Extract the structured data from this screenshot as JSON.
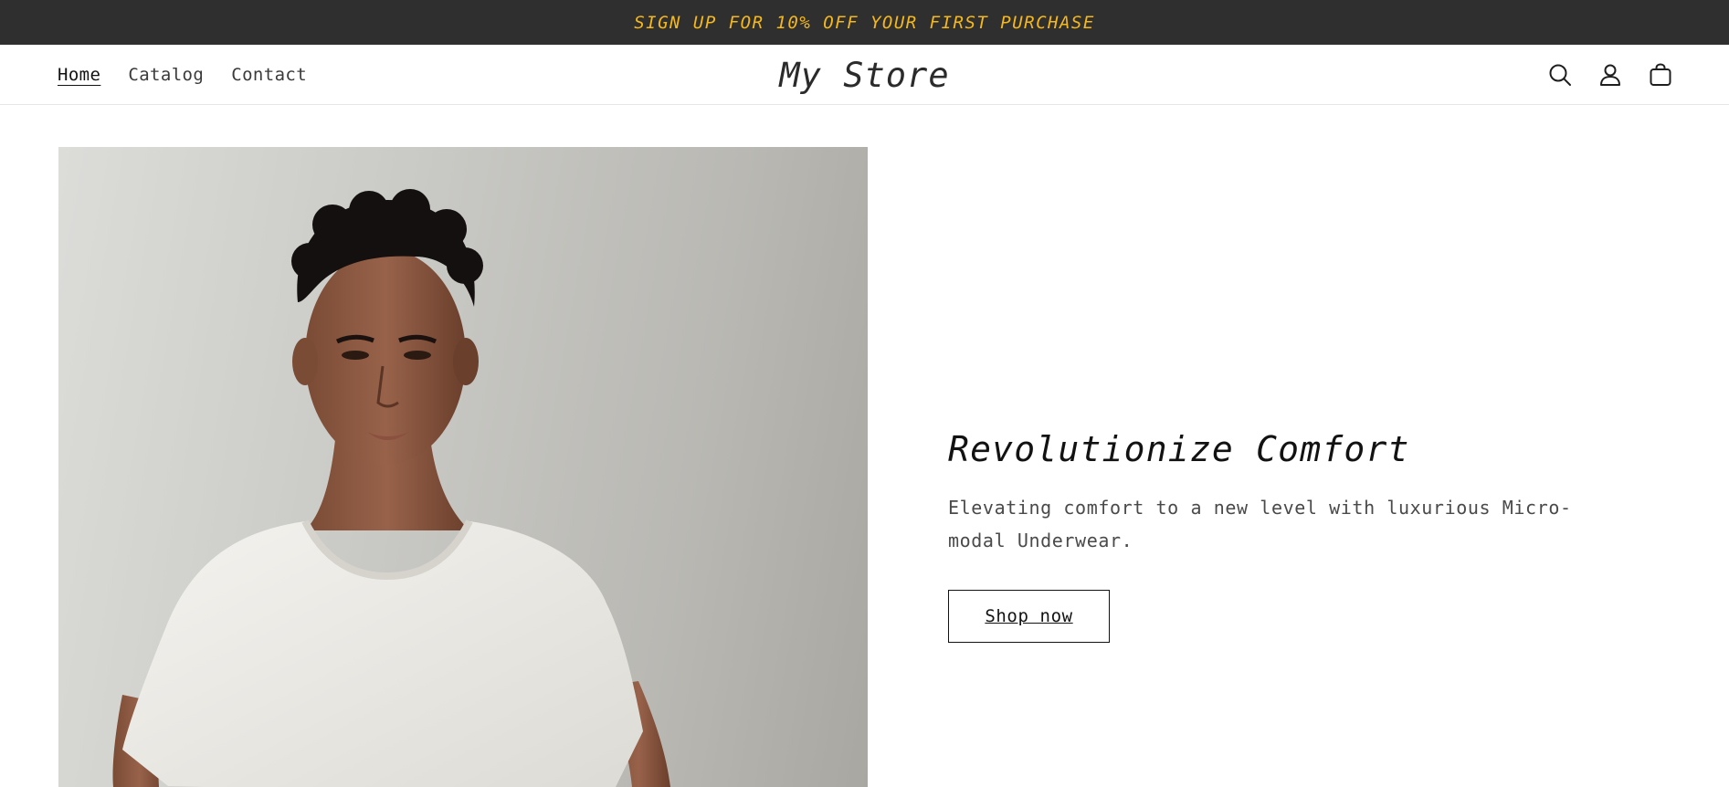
{
  "announcement": {
    "text": "SIGN UP FOR 10% OFF YOUR FIRST PURCHASE",
    "color": "#f5b81c",
    "background": "#2f2f2f"
  },
  "header": {
    "nav": [
      {
        "label": "Home",
        "active": true
      },
      {
        "label": "Catalog",
        "active": false
      },
      {
        "label": "Contact",
        "active": false
      }
    ],
    "logo": "My Store",
    "icons": [
      "search-icon",
      "account-icon",
      "cart-icon"
    ]
  },
  "hero": {
    "heading": "Revolutionize Comfort",
    "subheading": "Elevating comfort to a new level with luxurious Micro-modal Underwear.",
    "button_label": "Shop now",
    "image_description_icon": "model-photo"
  }
}
